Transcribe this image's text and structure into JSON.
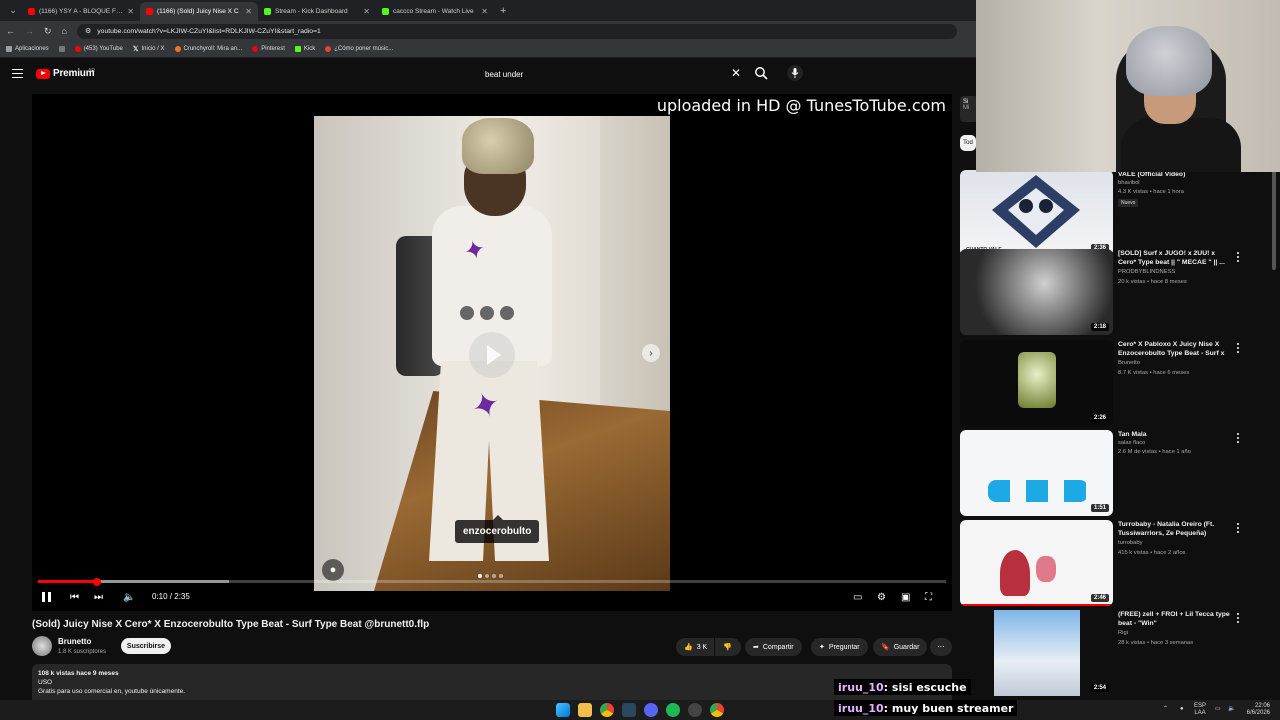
{
  "browser": {
    "tabs": [
      {
        "label": "(1166) YSY A - BLOQUE FINAL",
        "color": "#ff0000",
        "active": false
      },
      {
        "label": "(1166) (Sold) Juicy Nise X C",
        "color": "#ff0000",
        "active": true
      },
      {
        "label": "Stream - Kick Dashboard",
        "color": "#53fc18",
        "active": false
      },
      {
        "label": "caccco Stream - Watch Live",
        "color": "#53fc18",
        "active": false
      }
    ],
    "new_tab": "+",
    "url": "youtube.com/watch?v=LKJIW-CZuYI&list=RDLKJIW-CZuYI&start_radio=1",
    "bookmarks": [
      {
        "label": "Aplicaciones",
        "color": "#9aa0a6"
      },
      {
        "label": "(453) YouTube",
        "color": "#ff0000"
      },
      {
        "label": "Inicio / X",
        "color": "#ffffff"
      },
      {
        "label": "Crunchyroll: Mira an...",
        "color": "#f47521"
      },
      {
        "label": "Pinterest",
        "color": "#e60023"
      },
      {
        "label": "Kick",
        "color": "#53fc18"
      },
      {
        "label": "¿Cómo poner músic...",
        "color": "#ea4335"
      }
    ]
  },
  "youtube": {
    "brand": "Premium",
    "region": "AR",
    "search_query": "beat under",
    "clear_icon": "close-icon",
    "search_icon": "search-icon",
    "mic_icon": "mic-icon"
  },
  "player": {
    "overlay_text": "uploaded in HD @ TunesToTube.com",
    "photo_tag": "enzocerobulto",
    "time": "0:10 / 2:35",
    "progress": 0.065,
    "buffered": 0.21
  },
  "video": {
    "title": "(Sold) Juicy Nise X Cero* X Enzocerobulto Type Beat - Surf Type Beat @brunett0.flp",
    "channel": "Brunetto",
    "subscribers": "1.8 K suscriptores",
    "subscribe_label": "Suscribirse",
    "likes": "3 K",
    "share_label": "Compartir",
    "ask_label": "Preguntar",
    "save_label": "Guardar",
    "description": {
      "stats": "108 k vistas  hace 9 meses",
      "line1": "USO",
      "line2": "Gratis para uso comercial en, youtube únicamente."
    }
  },
  "sidebar": {
    "chip_top": "Si",
    "chip_top_sub": "Mi",
    "chip_all": "Tod"
  },
  "recommendations": [
    {
      "title": "VALE (Official Video)",
      "channel": "bhavibol",
      "meta": "4.3 K vistas • hace 1 hora",
      "badge": "Nuevo",
      "duration": "2:36",
      "thumb_label": "CUANTO VALE"
    },
    {
      "title": "[SOLD] Surf x JUGO! x 2UU! x Cero* Type beat || \" MECAE \" || ...",
      "channel": "PRODBYBLINDNESS",
      "meta": "20 k vistas • hace 8 meses",
      "badge": "",
      "duration": "2:18",
      "thumb_label": ""
    },
    {
      "title": "Cero* X Pabloxo X Juicy Nise X Enzocerobulto Type Beat - Surf x ...",
      "channel": "Brunetto",
      "meta": "8.7 K vistas • hace 6 meses",
      "badge": "",
      "duration": "2:26",
      "thumb_label": ""
    },
    {
      "title": "Tan Mala",
      "channel": "salas flaco",
      "meta": "2.6 M de vistas • hace 1 año",
      "badge": "",
      "duration": "1:51",
      "thumb_label": ""
    },
    {
      "title": "Turrobaby - Natalia Oreiro (Ft. Tussiwarriors, Ze Pequeña) (Prod...",
      "channel": "turrobaby",
      "meta": "415 k vistas • hace 2 años",
      "badge": "",
      "duration": "2:46",
      "thumb_label": ""
    },
    {
      "title": "(FREE) zell + FROI + Lil Tecca type beat - \"Win\"",
      "channel": "Rigi",
      "meta": "28 k vistas • hace 3 semanas",
      "badge": "",
      "duration": "2:54",
      "thumb_label": ""
    }
  ],
  "chat": [
    {
      "user": "iruu_10",
      "message": " : sisi escuche"
    },
    {
      "user": "iruu_10",
      "message": " : muy buen streamer"
    }
  ],
  "taskbar": {
    "lang": "ESP",
    "lang2": "LAA",
    "time": "22:06",
    "date": "6/6/2026"
  }
}
